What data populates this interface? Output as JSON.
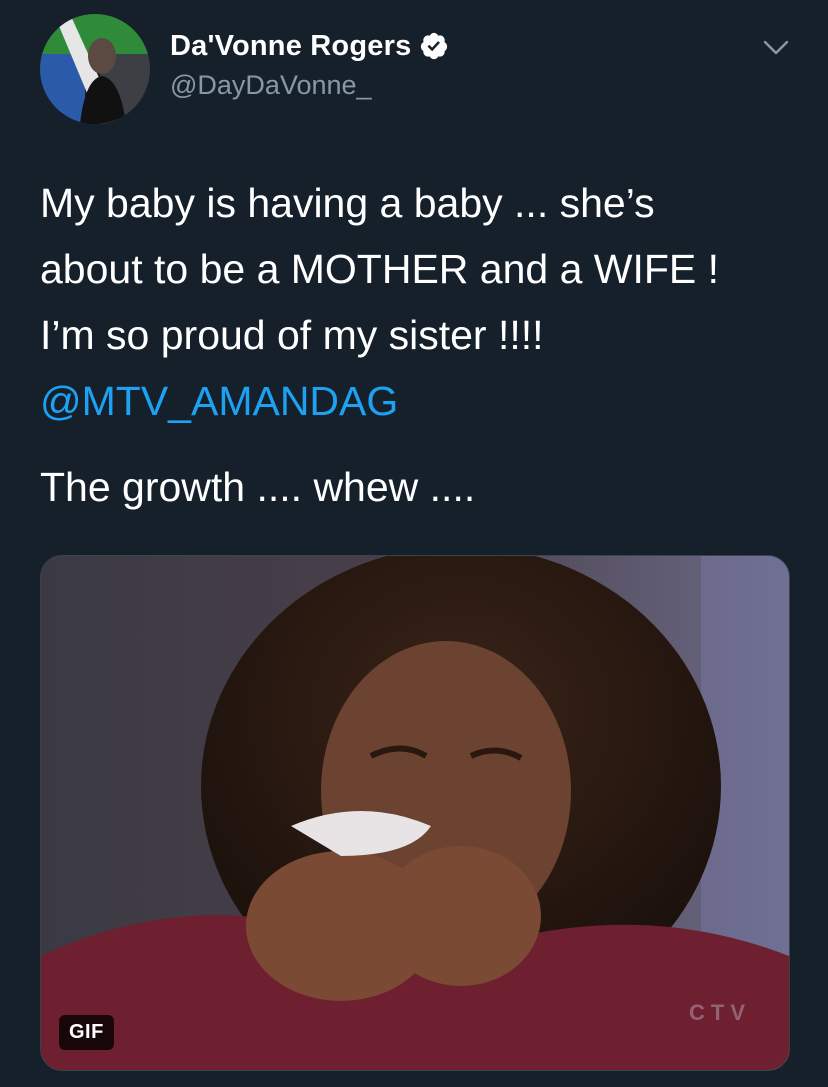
{
  "author": {
    "display_name": "Da'Vonne Rogers",
    "handle": "@DayDaVonne_",
    "verified": true
  },
  "tweet": {
    "lines": [
      "My baby is having a baby ... she’s",
      "about to be a MOTHER and a WIFE !",
      "I’m so proud of my sister !!!!"
    ],
    "mention": "@MTV_AMANDAG",
    "closing": "The growth .... whew ...."
  },
  "media": {
    "badge": "GIF",
    "watermark": "CTV"
  },
  "colors": {
    "background": "#15202b",
    "text": "#ffffff",
    "secondary": "#8899a6",
    "link": "#1da1f2"
  },
  "icons": {
    "verified": "verified-badge-icon",
    "menu": "chevron-down-icon"
  }
}
